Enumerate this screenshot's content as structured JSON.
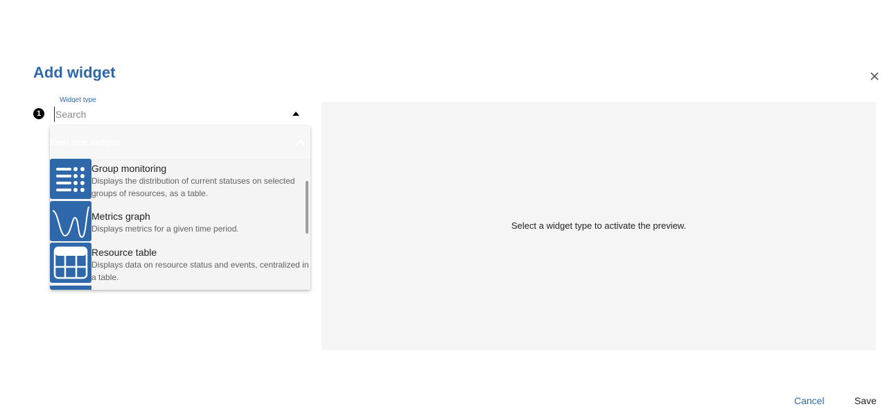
{
  "dialog": {
    "title": "Add widget"
  },
  "step": {
    "number": "1"
  },
  "widget_type": {
    "label": "Widget type",
    "placeholder": "Search"
  },
  "dropdown": {
    "group_title": "Real time widgets",
    "options": [
      {
        "title": "Group monitoring",
        "description": "Displays the distribution of current statuses on selected groups of resources, as a table.",
        "icon": "group-monitoring-icon"
      },
      {
        "title": "Metrics graph",
        "description": "Displays metrics for a given time period.",
        "icon": "metrics-graph-icon"
      },
      {
        "title": "Resource table",
        "description": "Displays data on resource status and events, centralized in a table.",
        "icon": "resource-table-icon"
      }
    ]
  },
  "preview": {
    "message": "Select a widget type to activate the preview."
  },
  "actions": {
    "cancel": "Cancel",
    "save": "Save"
  },
  "colors": {
    "accent": "#2e68aa",
    "preview_bg": "#f5f5f5"
  }
}
